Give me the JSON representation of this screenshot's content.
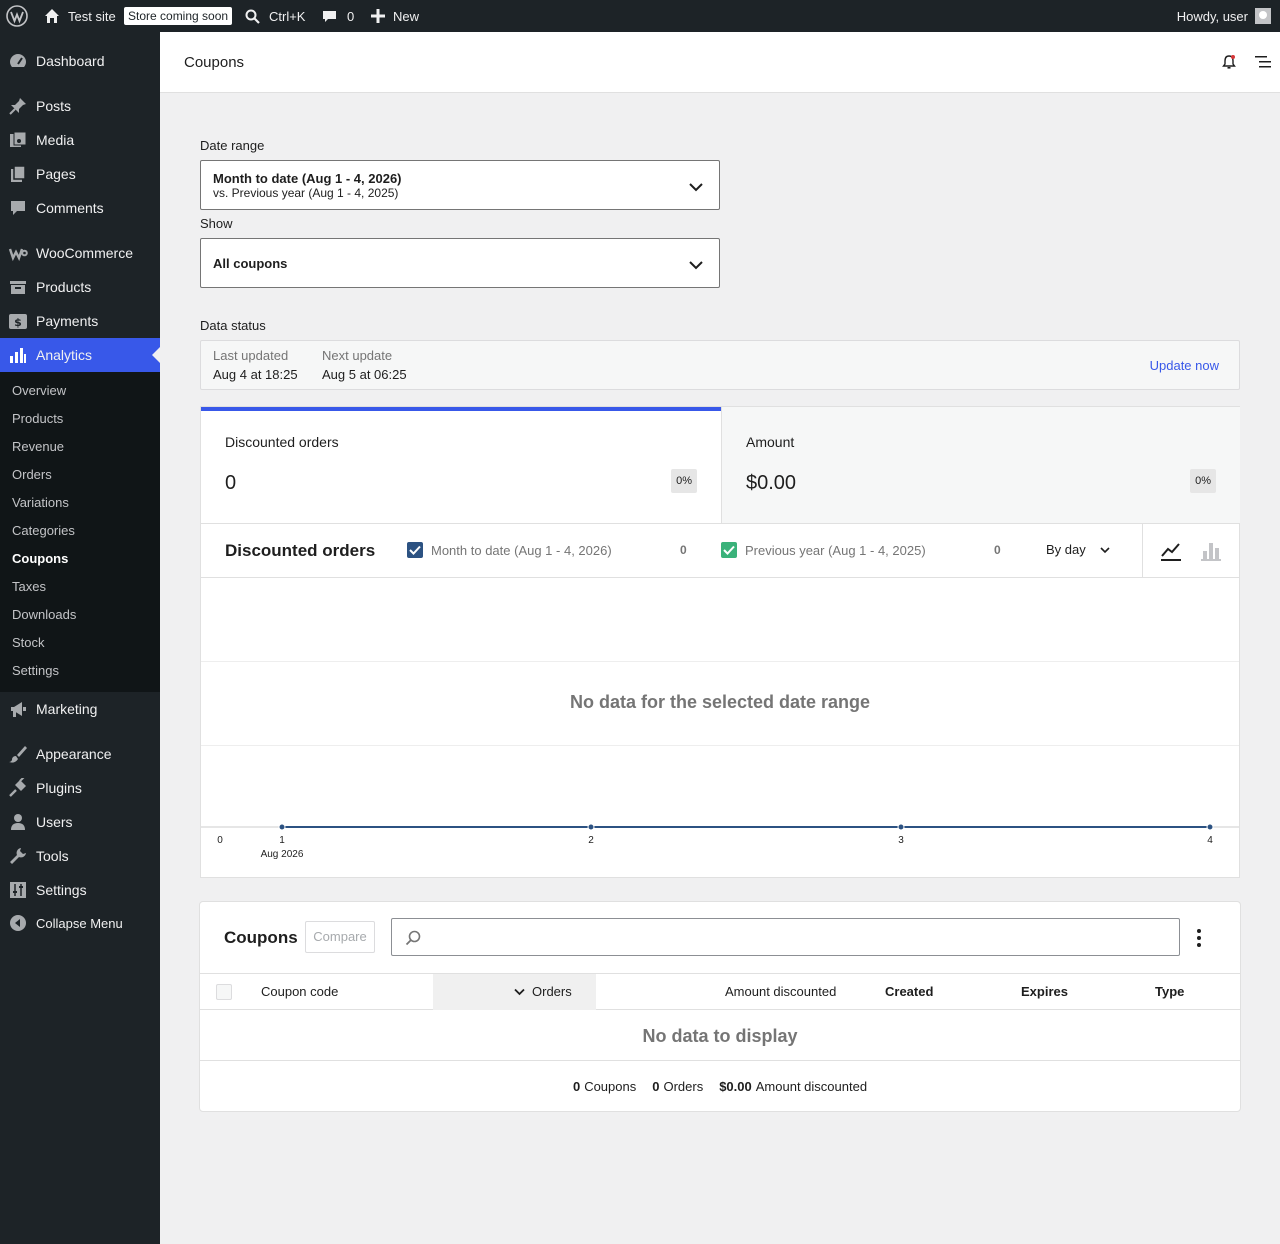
{
  "adminbar": {
    "site_name": "Test site",
    "store_badge": "Store coming soon",
    "search_shortcut": "Ctrl+K",
    "comments_count": "0",
    "new_label": "New",
    "greeting": "Howdy, user"
  },
  "sidebar": {
    "items": [
      {
        "label": "Dashboard",
        "icon": "dashboard-icon"
      },
      {
        "label": "Posts",
        "icon": "pin-icon"
      },
      {
        "label": "Media",
        "icon": "media-icon"
      },
      {
        "label": "Pages",
        "icon": "pages-icon"
      },
      {
        "label": "Comments",
        "icon": "comment-icon"
      },
      {
        "label": "WooCommerce",
        "icon": "woo-icon"
      },
      {
        "label": "Products",
        "icon": "archive-icon"
      },
      {
        "label": "Payments",
        "icon": "payments-icon"
      },
      {
        "label": "Analytics",
        "icon": "chart-bar-icon"
      },
      {
        "label": "Marketing",
        "icon": "megaphone-icon"
      },
      {
        "label": "Appearance",
        "icon": "brush-icon"
      },
      {
        "label": "Plugins",
        "icon": "plug-icon"
      },
      {
        "label": "Users",
        "icon": "user-icon"
      },
      {
        "label": "Tools",
        "icon": "wrench-icon"
      },
      {
        "label": "Settings",
        "icon": "sliders-icon"
      },
      {
        "label": "Collapse Menu",
        "icon": "collapse-icon"
      }
    ],
    "submenu": [
      "Overview",
      "Products",
      "Revenue",
      "Orders",
      "Variations",
      "Categories",
      "Coupons",
      "Taxes",
      "Downloads",
      "Stock",
      "Settings"
    ],
    "current_submenu": "Coupons"
  },
  "header": {
    "title": "Coupons"
  },
  "filters": {
    "date_range_label": "Date range",
    "date_range_value": "Month to date (Aug 1 - 4, 2026)",
    "date_range_compare": "vs. Previous year (Aug 1 - 4, 2025)",
    "show_label": "Show",
    "show_value": "All coupons"
  },
  "data_status": {
    "title": "Data status",
    "last_updated_label": "Last updated",
    "last_updated_value": "Aug 4 at 18:25",
    "next_update_label": "Next update",
    "next_update_value": "Aug 5 at 06:25",
    "update_now": "Update now"
  },
  "summary": [
    {
      "label": "Discounted orders",
      "value": "0",
      "delta": "0%"
    },
    {
      "label": "Amount",
      "value": "$0.00",
      "delta": "0%"
    }
  ],
  "chart": {
    "title": "Discounted orders",
    "legend": [
      {
        "label": "Month to date (Aug 1 - 4, 2026)",
        "total": "0",
        "color": "#2c5282"
      },
      {
        "label": "Previous year (Aug 1 - 4, 2025)",
        "total": "0",
        "color": "#3ab27a"
      }
    ],
    "interval": "By day",
    "no_data": "No data for the selected date range",
    "y_tick": "0",
    "month_label": "Aug 2026"
  },
  "chart_data": {
    "type": "line",
    "title": "Discounted orders",
    "x": [
      "1",
      "2",
      "3",
      "4"
    ],
    "series": [
      {
        "name": "Month to date (Aug 1 - 4, 2026)",
        "values": [
          0,
          0,
          0,
          0
        ]
      }
    ],
    "ylim": [
      0,
      0
    ]
  },
  "table": {
    "title": "Coupons",
    "compare": "Compare",
    "search_placeholder": "",
    "columns": [
      "Coupon code",
      "Orders",
      "Amount discounted",
      "Created",
      "Expires",
      "Type"
    ],
    "no_data": "No data to display",
    "footer": [
      {
        "value": "0",
        "label": "Coupons"
      },
      {
        "value": "0",
        "label": "Orders"
      },
      {
        "value": "$0.00",
        "label": "Amount discounted"
      }
    ]
  },
  "colors": {
    "accent": "#3858e9",
    "admin_bg": "#1d2327",
    "line_series": "#2c5282",
    "checkbox_secondary": "#3ab27a"
  }
}
